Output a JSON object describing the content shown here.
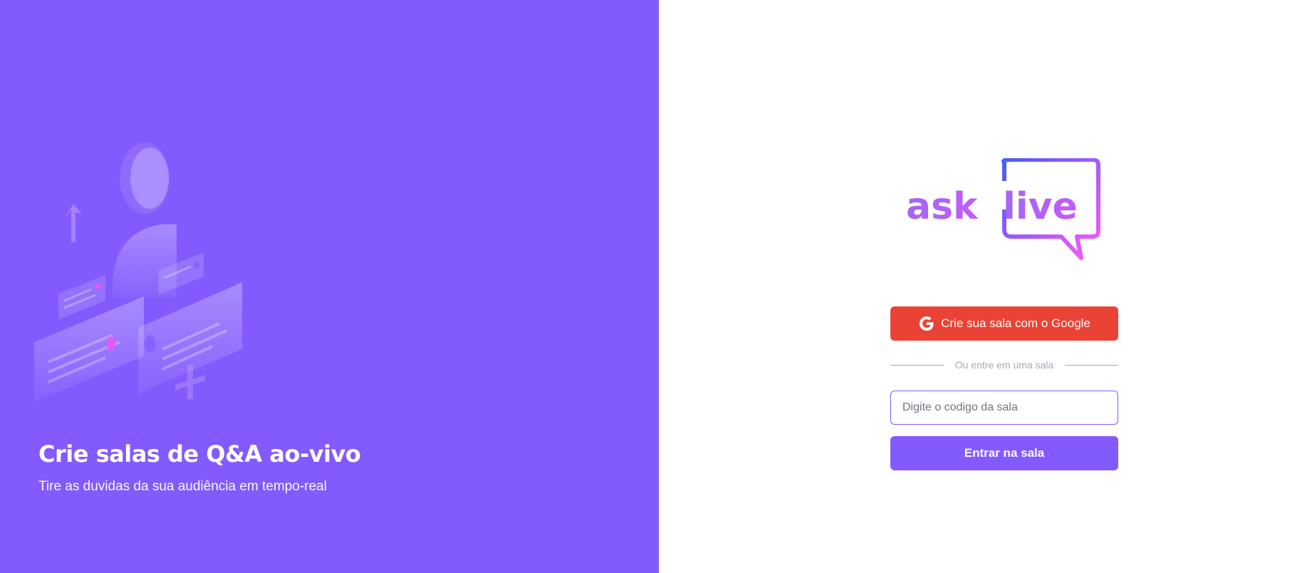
{
  "aside": {
    "title": "Crie salas de Q&A ao-vivo",
    "subtitle": "Tire as duvidas da sua audiência em tempo-real"
  },
  "logo": {
    "text_left": "ask",
    "text_right": "live"
  },
  "google_button": {
    "icon": "google-icon",
    "label": "Crie sua sala com o Google"
  },
  "separator": {
    "text": "Ou entre em uma sala"
  },
  "room_input": {
    "value": "",
    "placeholder": "Digite o codigo da sala"
  },
  "enter_button": {
    "label": "Entrar na sala"
  },
  "colors": {
    "primary": "#835afd",
    "google": "#ea4335",
    "separator": "#a8a8b3",
    "logo_gradient_start": "#835afd",
    "logo_gradient_end": "#e559f9"
  }
}
